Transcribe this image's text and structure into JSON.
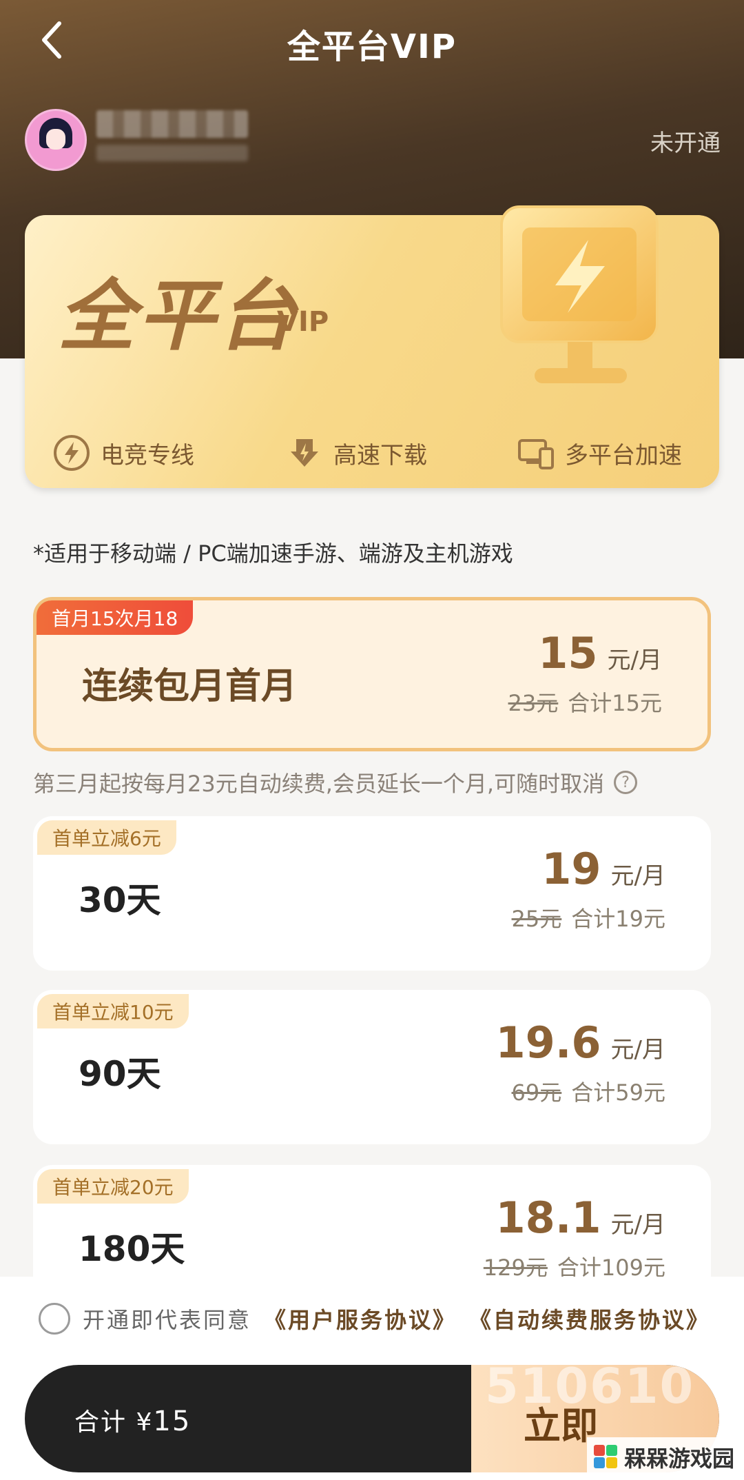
{
  "header": {
    "title": "全平台VIP",
    "back_label": "back"
  },
  "user": {
    "status": "未开通"
  },
  "vip_card": {
    "title": "全平台",
    "subtitle": "VIP",
    "features": [
      {
        "icon": "lightning-icon",
        "label": "电竞专线"
      },
      {
        "icon": "download-icon",
        "label": "高速下载"
      },
      {
        "icon": "multi-device-icon",
        "label": "多平台加速"
      }
    ]
  },
  "note": "*适用于移动端 / PC端加速手游、端游及主机游戏",
  "plans": [
    {
      "badge": "首月15次月18",
      "name": "连续包月首月",
      "price": "15",
      "unit": "元/月",
      "original": "23元",
      "total": "合计15元",
      "selected": true
    },
    {
      "badge": "首单立减6元",
      "name": "30天",
      "price": "19",
      "unit": "元/月",
      "original": "25元",
      "total": "合计19元",
      "selected": false
    },
    {
      "badge": "首单立减10元",
      "name": "90天",
      "price": "19.6",
      "unit": "元/月",
      "original": "69元",
      "total": "合计59元",
      "selected": false
    },
    {
      "badge": "首单立减20元",
      "name": "180天",
      "price": "18.1",
      "unit": "元/月",
      "original": "129元",
      "total": "合计109元",
      "selected": false
    }
  ],
  "renew_note": "第三月起按每月23元自动续费,会员延长一个月,可随时取消",
  "agreement": {
    "prefix": "开通即代表同意",
    "link1": "《用户服务协议》",
    "link2": "《自动续费服务协议》"
  },
  "payment": {
    "total_label": "合计",
    "currency": "¥",
    "amount": "15",
    "button_label": "立即",
    "button_deco": "510610"
  },
  "watermark": "槑槑游戏园",
  "colors": {
    "accent": "#8b6135",
    "badge_red": "#ef4d3a",
    "card_gold": "#f8d98a"
  }
}
